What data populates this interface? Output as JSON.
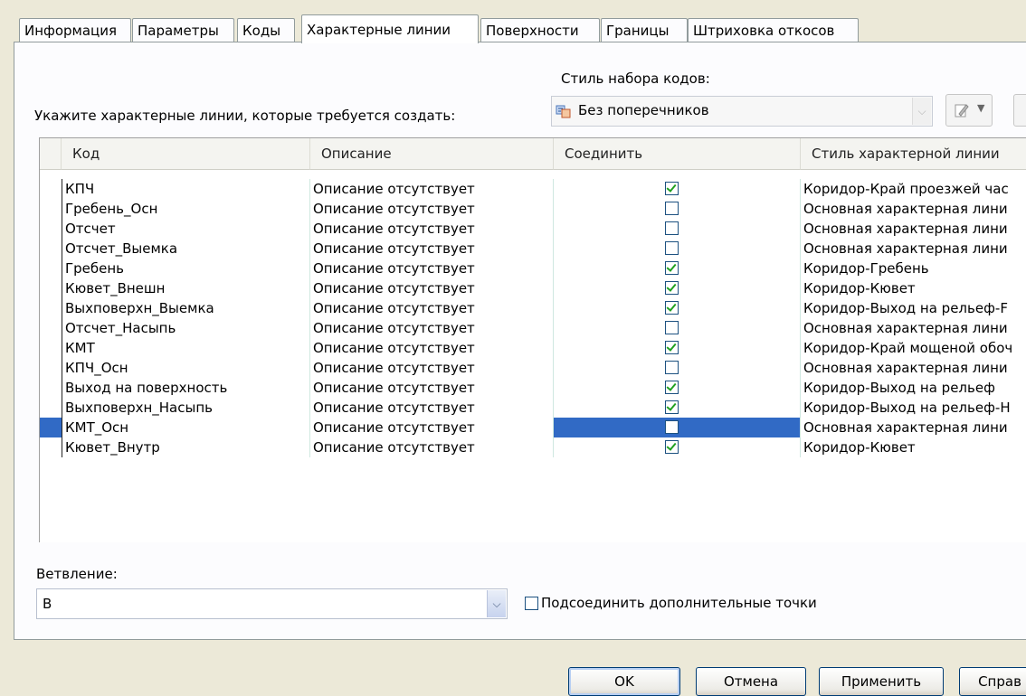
{
  "tabs": [
    {
      "label": "Информация",
      "active": false
    },
    {
      "label": "Параметры",
      "active": false
    },
    {
      "label": "Коды",
      "active": false
    },
    {
      "label": "Характерные линии",
      "active": true
    },
    {
      "label": "Поверхности",
      "active": false
    },
    {
      "label": "Границы",
      "active": false
    },
    {
      "label": "Штриховка откосов",
      "active": false
    }
  ],
  "code_set_style": {
    "label": "Стиль набора кодов:",
    "value": "Без поперечников",
    "icon": "code-set-icon"
  },
  "prompt": "Укажите характерные линии, которые требуется создать:",
  "table": {
    "columns": [
      "Код",
      "Описание",
      "Соединить",
      "Стиль характерной линии"
    ],
    "rows": [
      {
        "code": "КПЧ",
        "description": "Описание отсутствует",
        "connect": true,
        "style": "Коридор-Край проезжей час"
      },
      {
        "code": "Гребень_Осн",
        "description": "Описание отсутствует",
        "connect": false,
        "style": "Основная характерная лини"
      },
      {
        "code": "Отсчет",
        "description": "Описание отсутствует",
        "connect": false,
        "style": "Основная характерная лини"
      },
      {
        "code": "Отсчет_Выемка",
        "description": "Описание отсутствует",
        "connect": false,
        "style": "Основная характерная лини"
      },
      {
        "code": "Гребень",
        "description": "Описание отсутствует",
        "connect": true,
        "style": "Коридор-Гребень"
      },
      {
        "code": "Кювет_Внешн",
        "description": "Описание отсутствует",
        "connect": true,
        "style": "Коридор-Кювет"
      },
      {
        "code": "Выхповерхн_Выемка",
        "description": "Описание отсутствует",
        "connect": true,
        "style": "Коридор-Выход на рельеф-F"
      },
      {
        "code": "Отсчет_Насыпь",
        "description": "Описание отсутствует",
        "connect": false,
        "style": "Основная характерная лини"
      },
      {
        "code": "КМТ",
        "description": "Описание отсутствует",
        "connect": true,
        "style": "Коридор-Край мощеной обоч"
      },
      {
        "code": "КПЧ_Осн",
        "description": "Описание отсутствует",
        "connect": false,
        "style": "Основная характерная лини"
      },
      {
        "code": "Выход на поверхность",
        "description": "Описание отсутствует",
        "connect": true,
        "style": "Коридор-Выход на рельеф"
      },
      {
        "code": "Выхповерхн_Насыпь",
        "description": "Описание отсутствует",
        "connect": true,
        "style": "Коридор-Выход на рельеф-Н"
      },
      {
        "code": "КМТ_Осн",
        "description": "Описание отсутствует",
        "connect": false,
        "style": "Основная характерная лини",
        "current": true
      },
      {
        "code": "Кювет_Внутр",
        "description": "Описание отсутствует",
        "connect": true,
        "style": "Коридор-Кювет"
      }
    ]
  },
  "branching": {
    "label": "Ветвление:",
    "value": "В"
  },
  "connect_extra": {
    "label": "Подсоединить дополнительные точки",
    "checked": false
  },
  "buttons": {
    "ok": "OK",
    "cancel": "Отмена",
    "apply": "Применить",
    "help": "Справ"
  }
}
